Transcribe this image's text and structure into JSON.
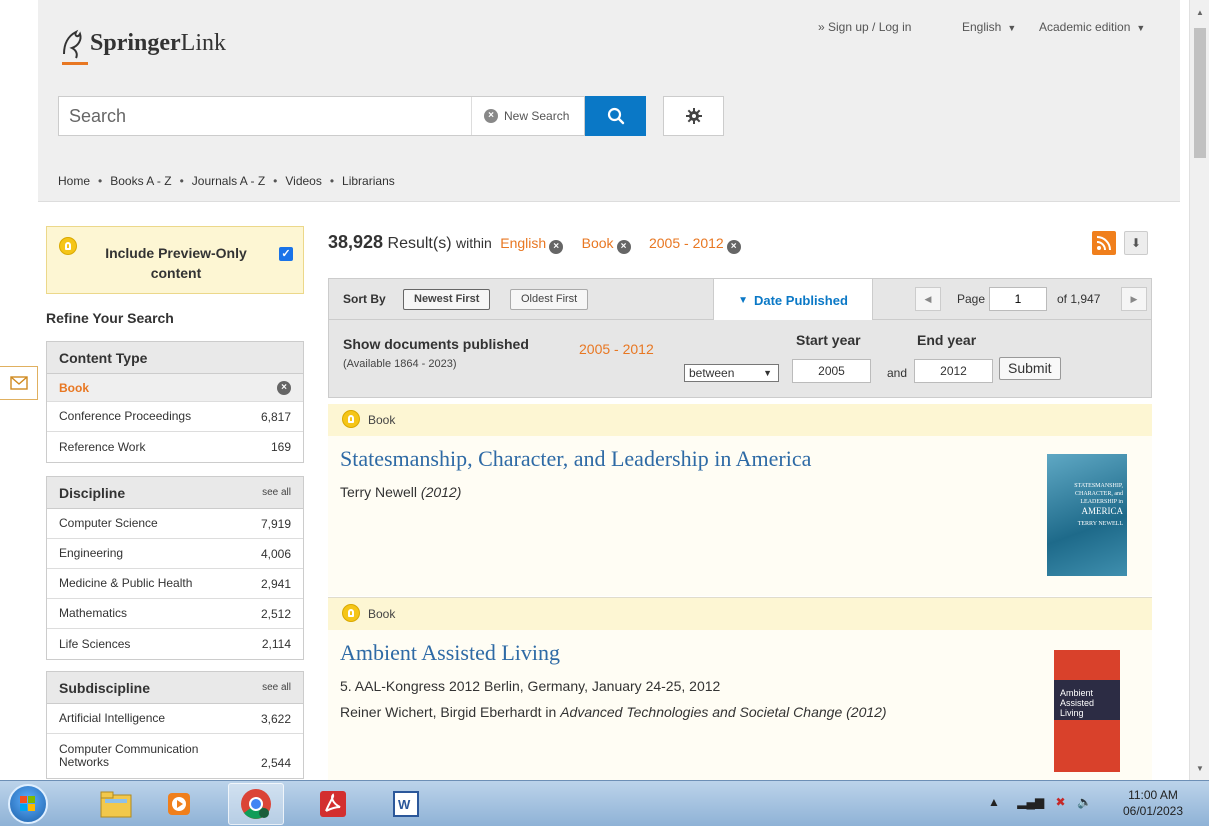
{
  "header": {
    "logo_text_bold": "Springer",
    "logo_text": "Link",
    "signup_link": "» Sign up / Log in",
    "language": "English",
    "edition": "Academic edition",
    "search_placeholder": "Search",
    "new_search": "New Search"
  },
  "nav": {
    "items": [
      "Home",
      "Books A - Z",
      "Journals A - Z",
      "Videos",
      "Librarians"
    ]
  },
  "sidebar": {
    "preview_label": "Include Preview-Only content",
    "preview_checked": true,
    "refine_title": "Refine Your Search",
    "content_type": {
      "title": "Content Type",
      "active": "Book",
      "items": [
        {
          "name": "Conference Proceedings",
          "count": "6,817"
        },
        {
          "name": "Reference Work",
          "count": "169"
        }
      ]
    },
    "discipline": {
      "title": "Discipline",
      "see_all": "see all",
      "items": [
        {
          "name": "Computer Science",
          "count": "7,919"
        },
        {
          "name": "Engineering",
          "count": "4,006"
        },
        {
          "name": "Medicine & Public Health",
          "count": "2,941"
        },
        {
          "name": "Mathematics",
          "count": "2,512"
        },
        {
          "name": "Life Sciences",
          "count": "2,114"
        }
      ]
    },
    "subdiscipline": {
      "title": "Subdiscipline",
      "see_all": "see all",
      "items": [
        {
          "name": "Artificial Intelligence",
          "count": "3,622"
        },
        {
          "name": "Computer Communication Networks",
          "count": "2,544"
        }
      ]
    }
  },
  "results": {
    "count": "38,928",
    "label": "Result(s)",
    "within": "within",
    "filters": [
      "English",
      "Book",
      "2005 - 2012"
    ]
  },
  "sort": {
    "label": "Sort By",
    "newest": "Newest First",
    "oldest": "Oldest First",
    "date_tab": "Date Published",
    "page_label": "Page",
    "page_value": "1",
    "of_label": "of 1,947"
  },
  "date_filter": {
    "show_docs": "Show documents published",
    "available": "(Available 1864 - 2023)",
    "range": "2005 - 2012",
    "start_label": "Start year",
    "end_label": "End year",
    "mode": "between",
    "start_value": "2005",
    "and_label": "and",
    "end_value": "2012",
    "submit": "Submit"
  },
  "items": [
    {
      "type": "Book",
      "title": "Statesmanship, Character, and Leadership in America",
      "author": "Terry Newell",
      "year": "(2012)",
      "cover_lines": [
        "STATESMANSHIP,",
        "CHARACTER, and",
        "LEADERSHIP in",
        "AMERICA",
        "TERRY NEWELL"
      ]
    },
    {
      "type": "Book",
      "title": "Ambient Assisted Living",
      "subtitle": "5. AAL-Kongress 2012 Berlin, Germany, January 24-25, 2012",
      "authors": "Reiner Wichert, Birgid Eberhardt in ",
      "series": "Advanced Technologies and Societal Change (2012)",
      "cover_lines": [
        "Ambient",
        "Assisted Living"
      ]
    }
  ],
  "taskbar": {
    "time": "11:00 AM",
    "date": "06/01/2023"
  },
  "colors": {
    "accent_orange": "#e87722",
    "link_blue": "#2e6aa5",
    "button_blue": "#0a78c6",
    "preview_yellow": "#fdf6d3"
  }
}
